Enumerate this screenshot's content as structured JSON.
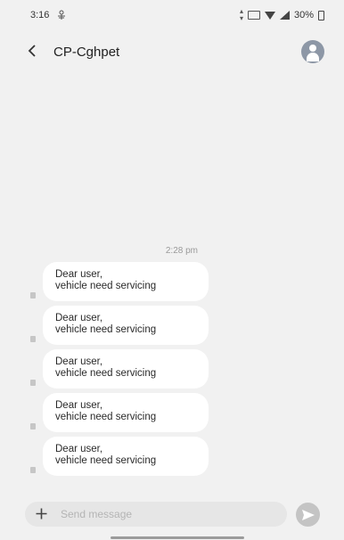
{
  "status_bar": {
    "time": "3:16",
    "battery_percent": "30%",
    "icons": [
      "notification-icon",
      "data-speed-icon",
      "box-icon",
      "wifi-icon",
      "signal-icon",
      "battery-icon"
    ]
  },
  "header": {
    "title": "CP-Cghpet",
    "back_icon": "chevron-left-icon",
    "avatar_icon": "contact-avatar-icon"
  },
  "conversation": {
    "timestamp": "2:28 pm",
    "messages": [
      {
        "line1": "Dear user,",
        "line2": "vehicle need servicing"
      },
      {
        "line1": "Dear user,",
        "line2": "vehicle need servicing"
      },
      {
        "line1": "Dear user,",
        "line2": "vehicle need servicing"
      },
      {
        "line1": "Dear user,",
        "line2": "vehicle need servicing"
      },
      {
        "line1": "Dear user,",
        "line2": "vehicle need servicing"
      }
    ]
  },
  "composer": {
    "placeholder": "Send message",
    "value": "",
    "plus_icon": "plus-icon",
    "send_icon": "send-icon"
  },
  "colors": {
    "background": "#f1f1f1",
    "bubble": "#ffffff",
    "send_button": "#c4c4c4",
    "avatar": "#8d97a6"
  }
}
